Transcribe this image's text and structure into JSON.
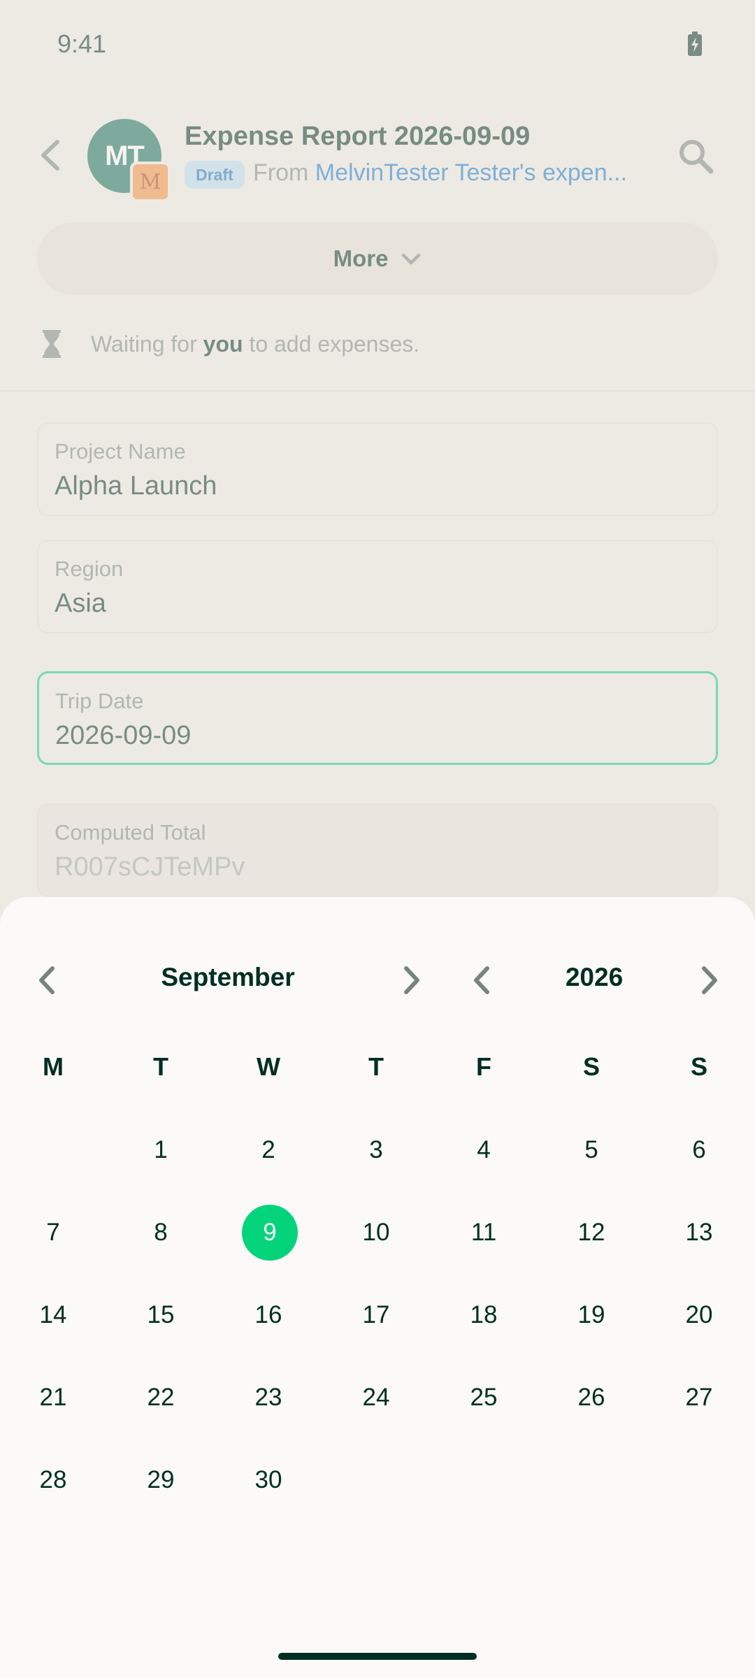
{
  "status_bar": {
    "time": "9:41"
  },
  "header": {
    "avatar_initials": "MT",
    "avatar_sub_initial": "M",
    "title": "Expense Report 2026-09-09",
    "badge": "Draft",
    "from_prefix": "From ",
    "from_link": "MelvinTester Tester's expen..."
  },
  "more_button": {
    "label": "More"
  },
  "waiting": {
    "prefix": "Waiting for ",
    "bold": "you",
    "suffix": " to add expenses."
  },
  "fields": [
    {
      "label": "Project Name",
      "value": "Alpha Launch"
    },
    {
      "label": "Region",
      "value": "Asia"
    },
    {
      "label": "Trip Date",
      "value": "2026-09-09"
    },
    {
      "label": "Computed Total",
      "value": "R007sCJTeMPv"
    }
  ],
  "calendar": {
    "month": "September",
    "year": "2026",
    "weekdays": [
      "M",
      "T",
      "W",
      "T",
      "F",
      "S",
      "S"
    ],
    "weeks": [
      [
        "",
        "1",
        "2",
        "3",
        "4",
        "5",
        "6"
      ],
      [
        "7",
        "8",
        "9",
        "10",
        "11",
        "12",
        "13"
      ],
      [
        "14",
        "15",
        "16",
        "17",
        "18",
        "19",
        "20"
      ],
      [
        "21",
        "22",
        "23",
        "24",
        "25",
        "26",
        "27"
      ],
      [
        "28",
        "29",
        "30",
        "",
        "",
        "",
        ""
      ]
    ],
    "selected_day": "9"
  },
  "colors": {
    "accent": "#03d47c",
    "text": "#002e22",
    "muted": "#76847e",
    "link": "#0e74c9",
    "badge_bg": "#b4dbf1"
  }
}
